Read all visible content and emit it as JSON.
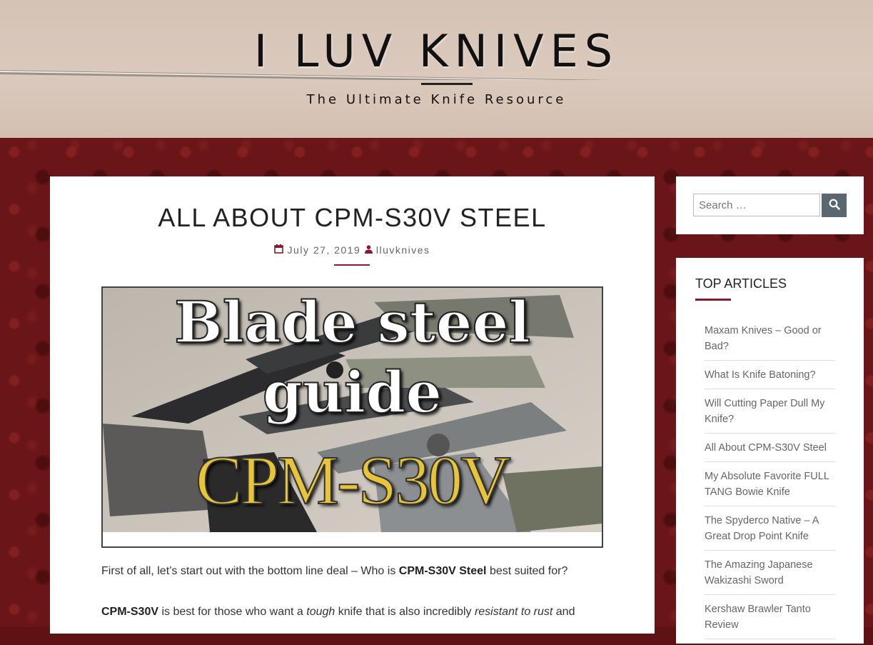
{
  "header": {
    "site_title": "I LUV KNIVES",
    "tagline": "The Ultimate Knife Resource"
  },
  "post": {
    "title": "ALL ABOUT CPM-S30V STEEL",
    "date": "July 27, 2019",
    "author": "lluvknives",
    "image_text": {
      "line1": "Blade steel",
      "line2": "guide",
      "line3": "CPM-S30V"
    },
    "para1": {
      "pre": "First of all, let’s start out with the bottom line deal – Who is ",
      "bold": "CPM-S30V Steel",
      "post": " best suited for?"
    },
    "para2": {
      "bold": "CPM-S30V",
      "t1": " is best for those who want a ",
      "em1": "tough",
      "t2": " knife that is also incredibly ",
      "em2": "resistant to rust",
      "t3": " and"
    }
  },
  "sidebar": {
    "search": {
      "placeholder": "Search …"
    },
    "top_articles": {
      "title": "TOP ARTICLES",
      "items": [
        "Maxam Knives – Good or Bad?",
        "What Is Knife Batoning?",
        "Will Cutting Paper Dull My Knife?",
        "All About CPM-S30V Steel",
        "My Absolute Favorite FULL TANG Bowie Knife",
        "The Spyderco Native – A Great Drop Point Knife",
        "The Amazing Japanese Wakizashi Sword",
        "Kershaw Brawler Tanto Review"
      ]
    }
  },
  "colors": {
    "accent": "#8a1a2a",
    "background": "#6a1517",
    "header_bg": "#d8c6ba",
    "search_button": "#5a6770",
    "title_gold": "#e8c43a"
  }
}
